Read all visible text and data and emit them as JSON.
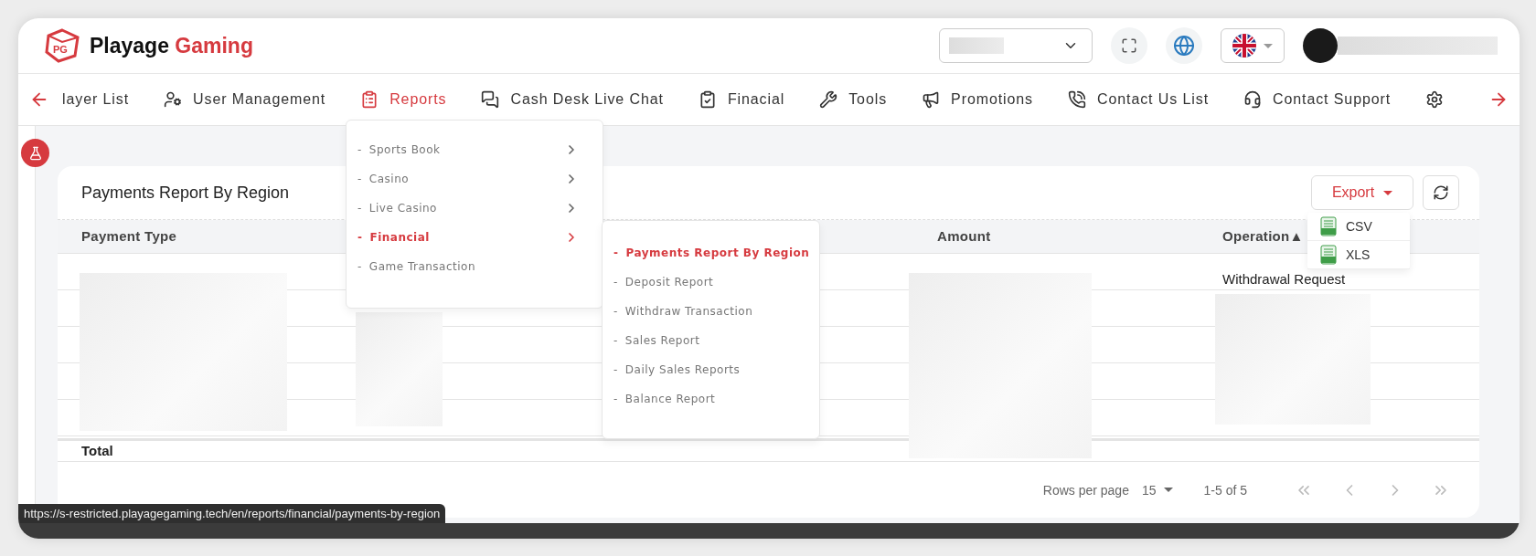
{
  "brand": {
    "name_part_1": "Playage",
    "name_part_2": "Gaming",
    "logo_letters": "PG"
  },
  "nav": {
    "items": [
      {
        "label": "layer List",
        "selected": false
      },
      {
        "label": "User Management",
        "selected": false
      },
      {
        "label": "Reports",
        "selected": true
      },
      {
        "label": "Cash Desk Live Chat",
        "selected": false
      },
      {
        "label": "Finacial",
        "selected": false
      },
      {
        "label": "Tools",
        "selected": false
      },
      {
        "label": "Promotions",
        "selected": false
      },
      {
        "label": "Contact Us List",
        "selected": false
      },
      {
        "label": "Contact Support",
        "selected": false
      },
      {
        "selected": false
      }
    ]
  },
  "reports_menu": {
    "items": [
      {
        "label": "Sports Book",
        "has_children": true,
        "selected": false
      },
      {
        "label": "Casino",
        "has_children": true,
        "selected": false
      },
      {
        "label": "Live Casino",
        "has_children": true,
        "selected": false
      },
      {
        "label": "Financial",
        "has_children": true,
        "selected": true
      },
      {
        "label": "Game Transaction",
        "has_children": false,
        "selected": false
      }
    ],
    "dash": "-",
    "submenu": [
      {
        "label": "Payments Report By Region",
        "selected": true
      },
      {
        "label": "Deposit Report",
        "selected": false
      },
      {
        "label": "Withdraw Transaction",
        "selected": false
      },
      {
        "label": "Sales Report",
        "selected": false
      },
      {
        "label": "Daily Sales Reports",
        "selected": false
      },
      {
        "label": "Balance Report",
        "selected": false
      }
    ]
  },
  "card": {
    "title": "Payments Report By Region",
    "export_label": "Export",
    "export_menu": [
      {
        "label": "CSV"
      },
      {
        "label": "XLS"
      }
    ],
    "columns": [
      {
        "label": "Payment Type"
      },
      {},
      {},
      {
        "label": "Amount"
      },
      {
        "label": "Operation",
        "sort": "▲"
      }
    ],
    "rows": [
      {
        "operation": "Withdrawal Request"
      },
      {},
      {},
      {},
      {}
    ],
    "total_label": "Total",
    "pagination": {
      "rows_per_page_label": "Rows per page",
      "rows_per_page": "15",
      "range": "1-5 of 5"
    }
  },
  "status_url": "https://s-restricted.playagegaming.tech/en/reports/financial/payments-by-region"
}
